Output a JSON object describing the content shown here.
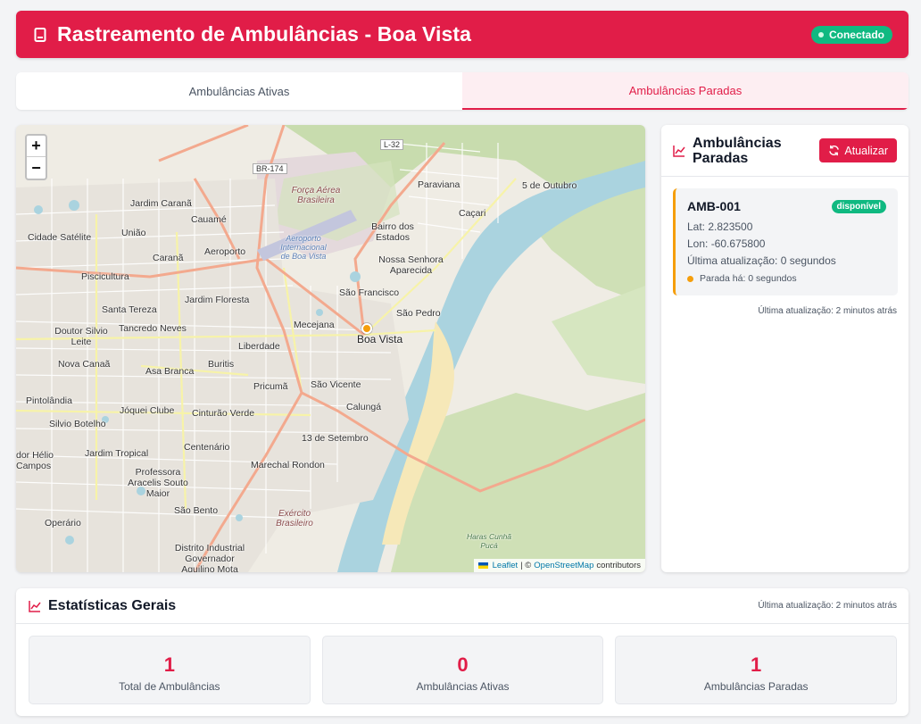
{
  "header": {
    "title": "Rastreamento de Ambulâncias - Boa Vista",
    "status": "Conectado",
    "colors": {
      "brand": "#e11d48",
      "success": "#10b981",
      "warning": "#f59e0b"
    }
  },
  "tabs": [
    {
      "label": "Ambulâncias Ativas",
      "active": false
    },
    {
      "label": "Ambulâncias Paradas",
      "active": true
    }
  ],
  "map": {
    "zoom_in": "+",
    "zoom_out": "−",
    "attribution": {
      "leaflet": "Leaflet",
      "sep": "| ©",
      "osm": "OpenStreetMap",
      "suffix": "contributors"
    },
    "labels": {
      "boa_vista": "Boa Vista",
      "paraviana": "Paraviana",
      "cinco_outubro": "5 de Outubro",
      "cacari": "Caçari",
      "jardim_carana": "Jardim Caranã",
      "cauame": "Cauamé",
      "uniao": "União",
      "cidade_satelite": "Cidade Satélite",
      "carana": "Caranã",
      "aeroporto": "Aeroporto",
      "bairro_estados": "Bairro dos Estados",
      "nossa_senhora": "Nossa Senhora Aparecida",
      "pricumalinha": "Piscicultura",
      "jardim_floresta": "Jardim Floresta",
      "sao_francisco": "São Francisco",
      "santa_tereza": "Santa Tereza",
      "sao_pedro": "São Pedro",
      "mecejana": "Mecejana",
      "doutor_silvio": "Doutor Silvio Leite",
      "tancredo": "Tancredo Neves",
      "liberdade": "Liberdade",
      "nova_canaa": "Nova Canaã",
      "asa_branca": "Asa Branca",
      "buritis": "Buritis",
      "pricuma": "Pricumã",
      "sao_vicente": "São Vicente",
      "pintolandia": "Pintolândia",
      "calunga": "Calungá",
      "joquei": "Jóquei Clube",
      "cinturao": "Cinturão Verde",
      "silvio_botelho": "Silvio Botelho",
      "treze_setembro": "13 de Setembro",
      "centenario": "Centenário",
      "jardim_tropical": "Jardim Tropical",
      "doutor_helio": "dor Hélio Campos",
      "marechal": "Marechal Rondon",
      "professora": "Professora Aracelis Souto Maior",
      "sao_bento": "São Bento",
      "operario": "Operário",
      "distrito": "Distrito Industrial Governador Aquilino Mota",
      "forca_aerea": "Força Aérea Brasileira",
      "aeroporto_int": "Aeroporto Internacional de Boa Vista",
      "exercito": "Exército Brasileiro",
      "haras": "Haras Cunhã Pucá",
      "br174": "BR-174",
      "l32": "L-32"
    }
  },
  "sidebar": {
    "title": "Ambulâncias Paradas",
    "refresh_label": "Atualizar",
    "ambulance": {
      "code": "AMB-001",
      "status": "disponível",
      "lat": "Lat: 2.823500",
      "lon": "Lon: -60.675800",
      "last_update": "Última atualização: 0 segundos",
      "stopped_for": "Parada há: 0 segundos"
    },
    "updated": "Última atualização: 2 minutos atrás"
  },
  "stats": {
    "title": "Estatísticas Gerais",
    "updated": "Última atualização: 2 minutos atrás",
    "items": [
      {
        "value": "1",
        "label": "Total de Ambulâncias"
      },
      {
        "value": "0",
        "label": "Ambulâncias Ativas"
      },
      {
        "value": "1",
        "label": "Ambulâncias Paradas"
      }
    ]
  }
}
